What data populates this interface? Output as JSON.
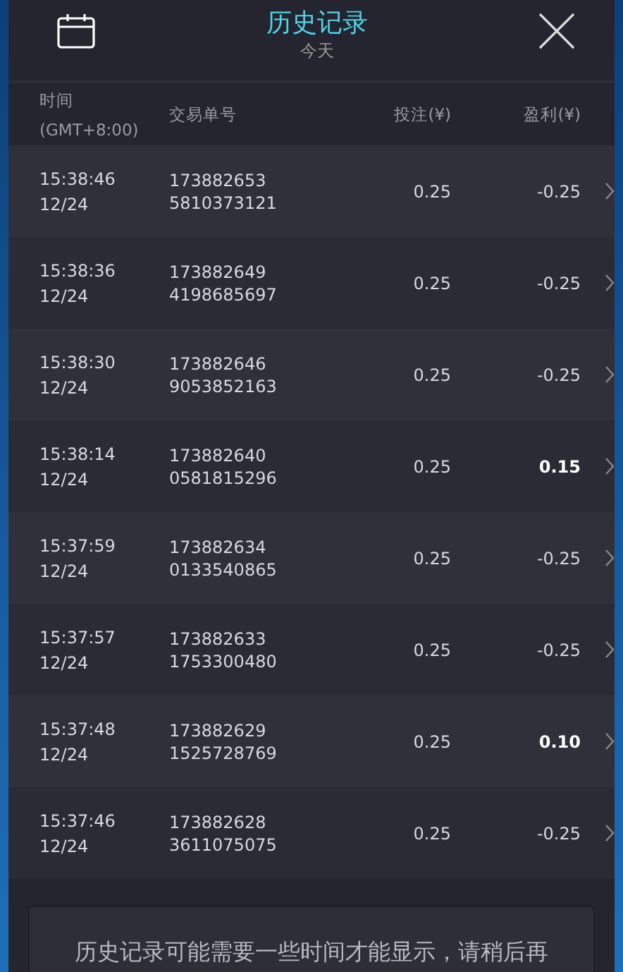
{
  "header": {
    "title": "历史记录",
    "subtitle": "今天"
  },
  "columns": [
    "时间",
    "(GMT+8:00)",
    "交易单号",
    "投注(¥)",
    "盈利(¥)"
  ],
  "rows": [
    {
      "time": "15:38:46",
      "date": "12/24",
      "id1": "173882653",
      "id2": "5810373121",
      "stake": "0.25",
      "profit": "-0.25",
      "win": false
    },
    {
      "time": "15:38:36",
      "date": "12/24",
      "id1": "173882649",
      "id2": "4198685697",
      "stake": "0.25",
      "profit": "-0.25",
      "win": false
    },
    {
      "time": "15:38:30",
      "date": "12/24",
      "id1": "173882646",
      "id2": "9053852163",
      "stake": "0.25",
      "profit": "-0.25",
      "win": false
    },
    {
      "time": "15:38:14",
      "date": "12/24",
      "id1": "173882640",
      "id2": "0581815296",
      "stake": "0.25",
      "profit": "0.15",
      "win": true
    },
    {
      "time": "15:37:59",
      "date": "12/24",
      "id1": "173882634",
      "id2": "0133540865",
      "stake": "0.25",
      "profit": "-0.25",
      "win": false
    },
    {
      "time": "15:37:57",
      "date": "12/24",
      "id1": "173882633",
      "id2": "1753300480",
      "stake": "0.25",
      "profit": "-0.25",
      "win": false
    },
    {
      "time": "15:37:48",
      "date": "12/24",
      "id1": "173882629",
      "id2": "1525728769",
      "stake": "0.25",
      "profit": "0.10",
      "win": true
    },
    {
      "time": "15:37:46",
      "date": "12/24",
      "id1": "173882628",
      "id2": "3611075075",
      "stake": "0.25",
      "profit": "-0.25",
      "win": false
    }
  ],
  "notice": "历史记录可能需要一些时间才能显示，请稍后再"
}
